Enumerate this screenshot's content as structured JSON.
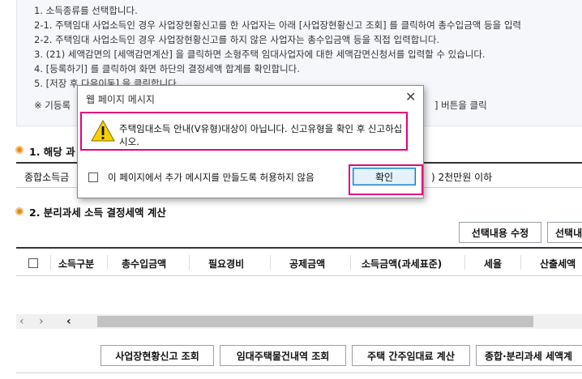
{
  "guide": {
    "lines": [
      "1. 소득종류를 선택합니다.",
      "2-1. 주택임대 사업소득인 경우 사업장현황신고를 한 사업자는 아래 [사업장현황신고 조회] 를 클릭하여 총수입금액 등을 입력",
      "2-2. 주택임대 사업소득인 경우 사업장현황신고를 하지 않은 사업자는 총수입금액 등을 직접 입력합니다.",
      "3. (21) 세액감면의 [세액감면계산] 을 클릭하면 소형주택 임대사업자에 대한 세액감면신청서를 입력할 수 있습니다.",
      "4. [등록하기] 를 클릭하여 화면 하단의 결정세액 합계를 확인합니다.",
      "5. [저장 후 다음이동] 을 클릭합니다."
    ],
    "note_start": "※ 기등록",
    "note_end": "] 버튼을 클릭"
  },
  "section1": {
    "title": "1. 해당 과",
    "row_label": "종합소득금",
    "row_value": ") 2천만원 이하"
  },
  "section2": {
    "title": "2. 분리과세 소득 결정세액 계산",
    "buttons": {
      "edit_selected": "선택내용 수정",
      "delete_selected": "선택내"
    },
    "columns": [
      "소득구분",
      "총수입금액",
      "필요경비",
      "공제금액",
      "소득금액(과세표준)",
      "세율",
      "산출세액"
    ]
  },
  "bottom_buttons": [
    "사업장현황신고 조회",
    "임대주택물건내역 조회",
    "주택 간주임대료 계산",
    "종합·분리과세 세액계"
  ],
  "dialog": {
    "title": "웹 페이지 메시지",
    "close_glyph": "✕",
    "message": "주택임대소득 안내(V유형)대상이 아닙니다. 신고유형을 확인 후 신고하십시오.",
    "suppress_label": "이 페이지에서 추가 메시지를 만들도록 허용하지 않음",
    "ok_label": "확인",
    "icon": "warning-icon"
  },
  "colors": {
    "highlight": "#e6007e",
    "section_dot": "#e58a1c",
    "guide_bg": "#f5f7fb",
    "warning_yellow": "#f7d000"
  }
}
